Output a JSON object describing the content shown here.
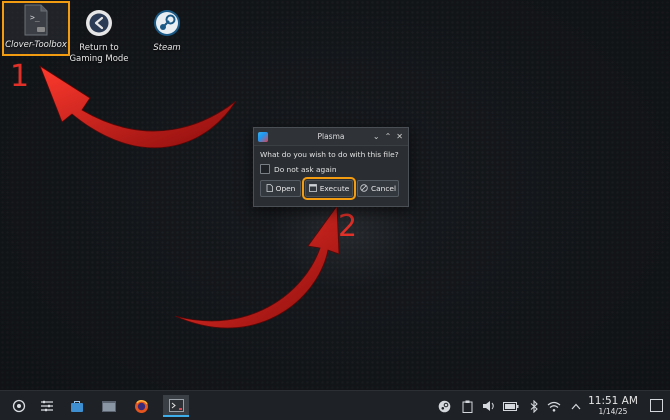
{
  "desktop": {
    "icons": [
      {
        "label": "Clover-Toolbox",
        "icon": "script-file-icon",
        "selected": true
      },
      {
        "label": "Return to Gaming Mode",
        "label_line1": "Return to",
        "label_line2": "Gaming Mode",
        "icon": "return-arrow-icon"
      },
      {
        "label": "Steam",
        "icon": "steam-icon"
      }
    ]
  },
  "annotations": {
    "step1": "1",
    "step2": "2",
    "arrow_color": "#d81e1e",
    "highlight_color": "#f39c12"
  },
  "dialog": {
    "title": "Plasma",
    "question": "What do you wish to do with this file?",
    "checkbox_label": "Do not ask again",
    "checkbox_checked": false,
    "buttons": {
      "open": "Open",
      "execute": "Execute",
      "cancel": "Cancel"
    },
    "controls": {
      "minimize": "⌄",
      "maximize": "⌃",
      "close": "✕"
    }
  },
  "taskbar": {
    "launcher_items": [
      "app-launcher-icon",
      "task-manager-icon",
      "discover-store-icon",
      "file-manager-icon",
      "firefox-icon",
      "konsole-icon"
    ],
    "tray_items": [
      "steam-tray-icon",
      "clipboard-icon",
      "volume-icon",
      "battery-icon",
      "bluetooth-icon",
      "wifi-icon",
      "expand-tray-icon"
    ],
    "clock": {
      "time": "11:51 AM",
      "date": "1/14/25"
    },
    "accent": "#3daee9"
  }
}
